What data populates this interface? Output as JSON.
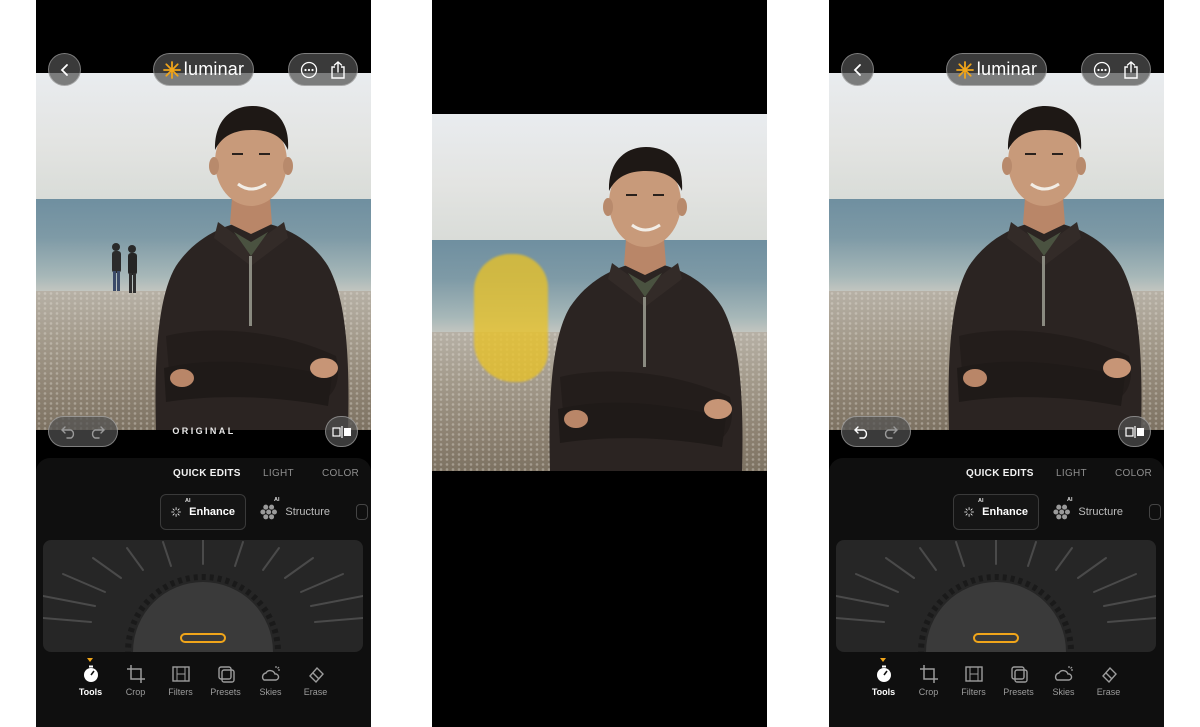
{
  "app": {
    "logo_text": "luminar",
    "accent_color": "#f0a51a"
  },
  "screens": [
    {
      "id": "left",
      "overlay_label": "ORIGINAL",
      "tabs": [
        {
          "label": "QUICK EDITS",
          "active": true
        },
        {
          "label": "LIGHT",
          "active": false
        },
        {
          "label": "COLOR",
          "active": false
        }
      ],
      "tools": [
        {
          "label": "Enhance",
          "badge": "AI",
          "icon": "sparkle-icon",
          "active": true
        },
        {
          "label": "Structure",
          "badge": "AI",
          "icon": "hexagon-cluster-icon",
          "active": false
        }
      ],
      "nav": [
        {
          "label": "Tools",
          "icon": "timer-icon",
          "active": true
        },
        {
          "label": "Crop",
          "icon": "crop-icon"
        },
        {
          "label": "Filters",
          "icon": "film-icon"
        },
        {
          "label": "Presets",
          "icon": "presets-icon"
        },
        {
          "label": "Skies",
          "icon": "sky-icon"
        },
        {
          "label": "Erase",
          "icon": "eraser-icon"
        }
      ]
    },
    {
      "id": "middle",
      "mask_color": "#e8c228"
    },
    {
      "id": "right",
      "tabs": [
        {
          "label": "QUICK EDITS",
          "active": true
        },
        {
          "label": "LIGHT",
          "active": false
        },
        {
          "label": "COLOR",
          "active": false
        }
      ],
      "tools": [
        {
          "label": "Enhance",
          "badge": "AI",
          "icon": "sparkle-icon",
          "active": true
        },
        {
          "label": "Structure",
          "badge": "AI",
          "icon": "hexagon-cluster-icon",
          "active": false
        }
      ],
      "nav": [
        {
          "label": "Tools",
          "icon": "timer-icon",
          "active": true
        },
        {
          "label": "Crop",
          "icon": "crop-icon"
        },
        {
          "label": "Filters",
          "icon": "film-icon"
        },
        {
          "label": "Presets",
          "icon": "presets-icon"
        },
        {
          "label": "Skies",
          "icon": "sky-icon"
        },
        {
          "label": "Erase",
          "icon": "eraser-icon"
        }
      ]
    }
  ]
}
